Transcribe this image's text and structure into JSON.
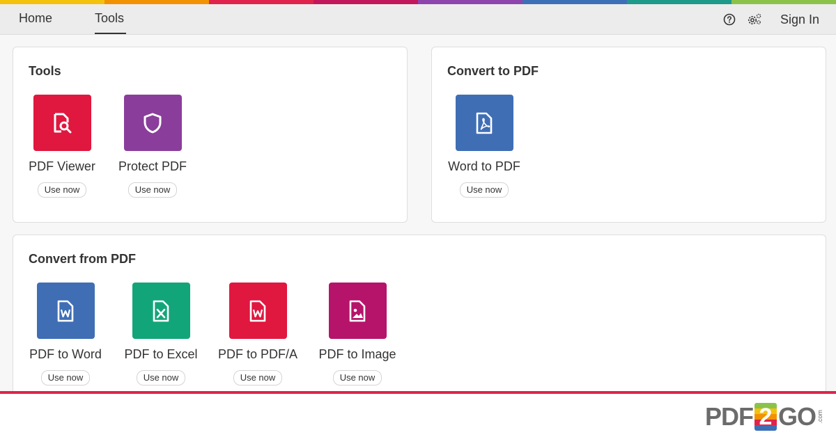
{
  "colors": {
    "rainbow": [
      "#f4c20d",
      "#f29200",
      "#e0234a",
      "#c2185b",
      "#8e44ad",
      "#3d6fb6",
      "#1d9a8a",
      "#8bc34a"
    ],
    "red": "#e0173f",
    "purple": "#8a3d9b",
    "blue": "#3f6eb5",
    "green": "#13a57a",
    "magenta": "#b5146a"
  },
  "nav": {
    "home": "Home",
    "tools": "Tools",
    "help_icon": "help-circle-icon",
    "settings_icon": "settings-gears-icon",
    "sign_in": "Sign In"
  },
  "tools_card": {
    "title": "Tools",
    "items": [
      {
        "label": "PDF Viewer",
        "button": "Use now",
        "icon": "document-search-icon"
      },
      {
        "label": "Protect PDF",
        "button": "Use now",
        "icon": "shield-icon"
      }
    ]
  },
  "convert_to_card": {
    "title": "Convert to PDF",
    "items": [
      {
        "label": "Word to PDF",
        "button": "Use now",
        "icon": "pdf-file-icon"
      }
    ]
  },
  "convert_from_card": {
    "title": "Convert from PDF",
    "items": [
      {
        "label": "PDF to Word",
        "button": "Use now",
        "icon": "word-file-icon"
      },
      {
        "label": "PDF to Excel",
        "button": "Use now",
        "icon": "excel-file-icon"
      },
      {
        "label": "PDF to PDF/A",
        "button": "Use now",
        "icon": "word-file-icon"
      },
      {
        "label": "PDF to Image",
        "button": "Use now",
        "icon": "image-file-icon"
      }
    ]
  },
  "logo": {
    "left": "PDF",
    "middle": "2",
    "right": "GO",
    "suffix": ".com"
  }
}
